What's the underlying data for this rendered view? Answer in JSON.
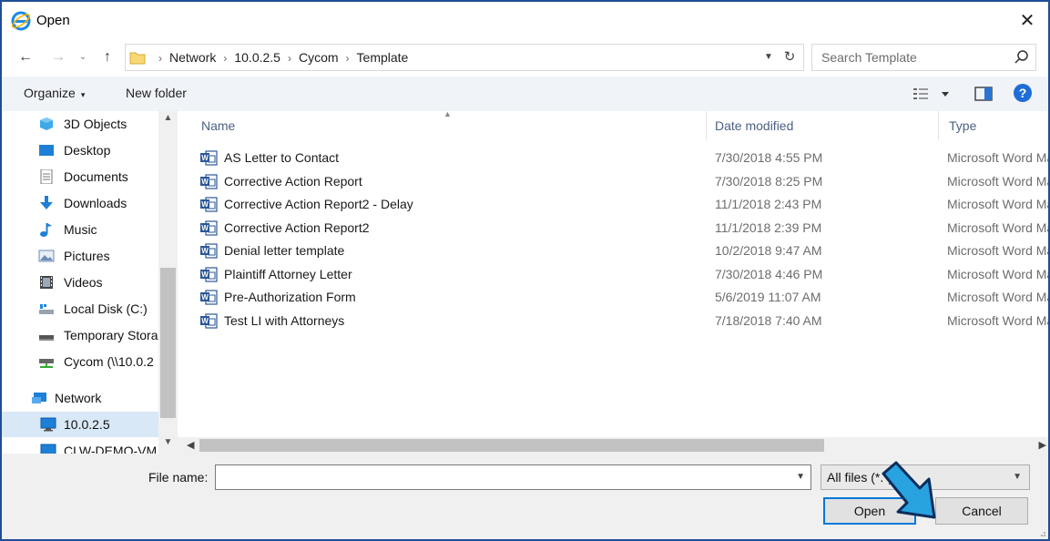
{
  "window": {
    "title": "Open",
    "close_glyph": "✕"
  },
  "address": {
    "crumbs": [
      "Network",
      "10.0.2.5",
      "Cycom",
      "Template"
    ],
    "separator": "›",
    "search_placeholder": "Search Template"
  },
  "toolbar": {
    "organize_label": "Organize",
    "organize_caret": "▾",
    "new_folder_label": "New folder",
    "help_label": "?"
  },
  "sidebar": {
    "items": [
      {
        "label": "3D Objects",
        "icon": "3d-objects-icon"
      },
      {
        "label": "Desktop",
        "icon": "desktop-icon"
      },
      {
        "label": "Documents",
        "icon": "documents-icon"
      },
      {
        "label": "Downloads",
        "icon": "downloads-icon"
      },
      {
        "label": "Music",
        "icon": "music-icon"
      },
      {
        "label": "Pictures",
        "icon": "pictures-icon"
      },
      {
        "label": "Videos",
        "icon": "videos-icon"
      },
      {
        "label": "Local Disk (C:)",
        "icon": "local-disk-icon"
      },
      {
        "label": "Temporary Stora",
        "icon": "drive-icon"
      },
      {
        "label": "Cycom (\\\\10.0.2",
        "icon": "network-drive-icon"
      },
      {
        "label": "Network",
        "icon": "network-icon"
      },
      {
        "label": "10.0.2.5",
        "icon": "computer-icon"
      },
      {
        "label": "CLW-DEMO-VM",
        "icon": "computer-icon"
      }
    ]
  },
  "columns": {
    "name": "Name",
    "date": "Date modified",
    "type": "Type"
  },
  "files": [
    {
      "name": "AS Letter to Contact",
      "date": "7/30/2018 4:55 PM",
      "type": "Microsoft Word Macro-Enabled Template"
    },
    {
      "name": "Corrective Action Report",
      "date": "7/30/2018 8:25 PM",
      "type": "Microsoft Word Macro-Enabled Template"
    },
    {
      "name": "Corrective Action Report2 - Delay",
      "date": "11/1/2018 2:43 PM",
      "type": "Microsoft Word Macro-Enabled Template"
    },
    {
      "name": "Corrective Action Report2",
      "date": "11/1/2018 2:39 PM",
      "type": "Microsoft Word Macro-Enabled Template"
    },
    {
      "name": "Denial letter template",
      "date": "10/2/2018 9:47 AM",
      "type": "Microsoft Word Macro-Enabled Template"
    },
    {
      "name": "Plaintiff Attorney Letter",
      "date": "7/30/2018 4:46 PM",
      "type": "Microsoft Word Macro-Enabled Template"
    },
    {
      "name": "Pre-Authorization Form",
      "date": "5/6/2019 11:07 AM",
      "type": "Microsoft Word Macro-Enabled Template"
    },
    {
      "name": "Test LI with Attorneys",
      "date": "7/18/2018 7:40 AM",
      "type": "Microsoft Word Macro-Enabled Template"
    }
  ],
  "bottom": {
    "file_name_label": "File name:",
    "file_name_value": "",
    "file_type_value": "All files (*.*)",
    "open_label": "Open",
    "cancel_label": "Cancel"
  },
  "colors": {
    "window_border": "#1f4e97",
    "accent": "#0078d7",
    "annotation_arrow": "#29a3e0"
  }
}
